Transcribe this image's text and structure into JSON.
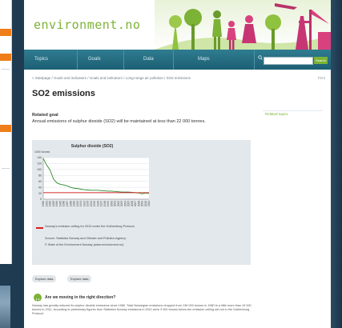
{
  "site": {
    "logo": "environment.no"
  },
  "nav": {
    "items": [
      "Topics",
      "Goals",
      "Data",
      "Maps"
    ],
    "search_button": "Search"
  },
  "breadcrumb": "« Startpage / Goals and indicators / Goals and indicators / Long-range air pollution / SO2 emissions",
  "print_label": "Print",
  "page_title": "SO2 emissions",
  "related_topics": "Related topics",
  "goal": {
    "heading": "Related goal",
    "text": "Annual emissions of sulphur dioxide (SO2) will be maintained at less than 22 000 tonnes."
  },
  "chart_data": {
    "type": "line",
    "title": "Sulphur dioxide (SO2)",
    "ylabel": "1000 tonnes",
    "ylim": [
      0,
      140
    ],
    "yticks": [
      0,
      20,
      40,
      60,
      80,
      100,
      120,
      140
    ],
    "x": [
      1980,
      1981,
      1982,
      1983,
      1984,
      1985,
      1986,
      1987,
      1988,
      1989,
      1990,
      1991,
      1992,
      1993,
      1994,
      1995,
      1996,
      1997,
      1998,
      1999,
      2000,
      2001,
      2002,
      2003,
      2004,
      2005,
      2006,
      2007,
      2008,
      2009,
      2010,
      2011
    ],
    "series": [
      {
        "color": "#2e8b2e",
        "values": [
          137,
          115,
          98,
          68,
          55,
          50,
          48,
          45,
          40,
          37,
          36,
          34,
          32,
          31,
          30,
          30,
          30,
          29,
          28,
          27,
          27,
          26,
          25,
          24,
          24,
          24,
          23,
          22,
          21,
          18,
          21,
          19
        ]
      },
      {
        "color": "#d91e1e",
        "values": [
          22,
          22,
          22,
          22,
          22,
          22,
          22,
          22,
          22,
          22,
          22,
          22,
          22,
          22,
          22,
          22,
          22,
          22,
          22,
          22,
          22,
          22,
          22,
          22,
          22,
          22,
          22,
          22,
          22,
          22,
          22,
          22
        ]
      }
    ],
    "legend": "Norway's emission ceiling for 2010 under the Gothenburg Protocol.",
    "source": "Source: Statistics Norway and Climate and Pollution Agency",
    "copyright": "© State of the Environment Norway (www.environment.no)"
  },
  "buttons": {
    "explore1": "Explore data",
    "explore2": "Explore data"
  },
  "question": {
    "title": "Are we moving in the right direction?",
    "text": "Norway has greatly reduced its sulphur dioxide emissions since 1980. Total Norwegian emissions dropped from 136 000 tonnes in 1980 to a little more than 19 000 tonnes in 2011. According to preliminary figures from Statistics Norway emissions in 2011 were 3 000 tonnes below the emission ceiling set out in the Gothenburg Protocol."
  },
  "colors": {
    "accent": "#7cb236",
    "nav": "#236a7f",
    "ceiling": "#d91e1e",
    "series": "#2e8b2e"
  }
}
